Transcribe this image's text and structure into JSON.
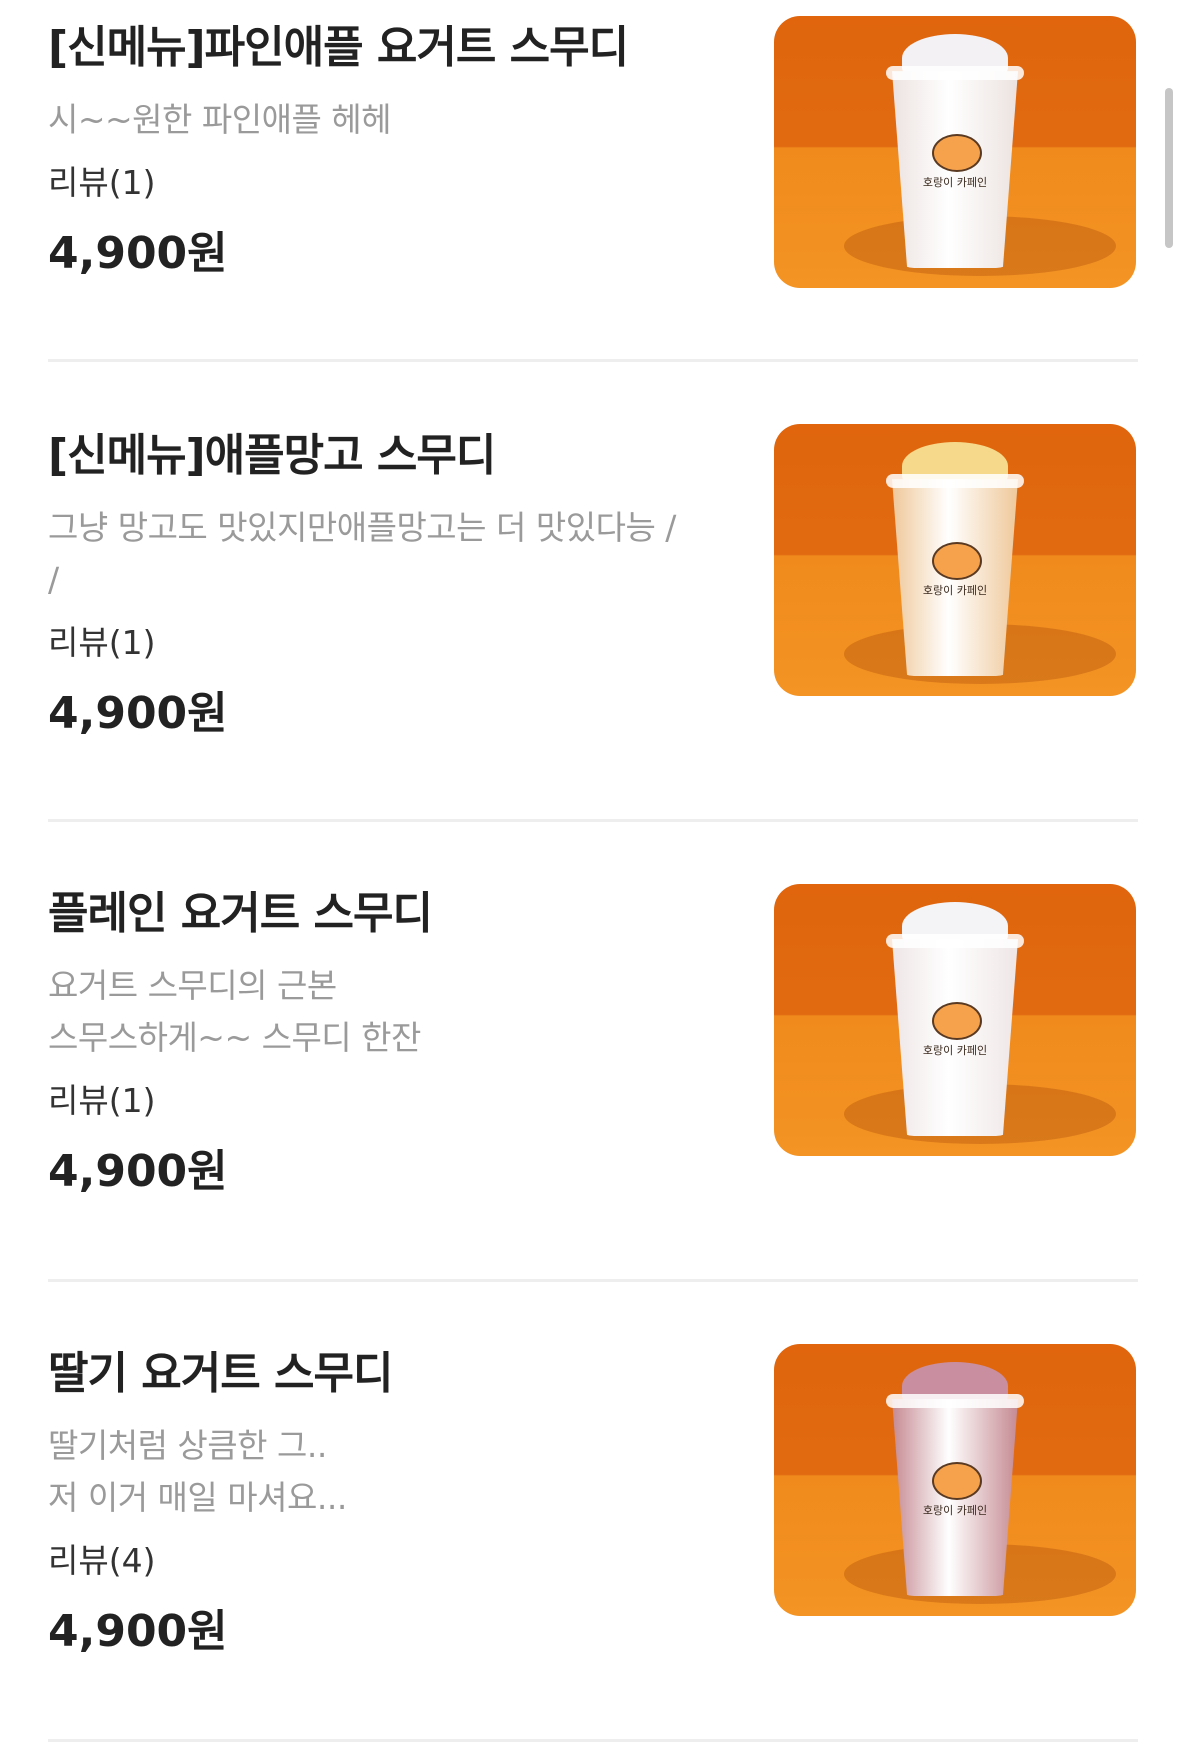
{
  "menu": {
    "items": [
      {
        "name": "[신메뉴]파인애플 요거트 스무디",
        "desc_lines": [
          "시~~원한 파인애플 헤헤"
        ],
        "review": "리뷰(1)",
        "price": "4,900원",
        "image_alt": "pineapple-yogurt-smoothie-photo",
        "cup_color": "#ece3e0",
        "foam_color": "#f3f1f4",
        "logo_text": "호랑이 카페인"
      },
      {
        "name": "[신메뉴]애플망고 스무디",
        "desc_lines": [
          "그냥 망고도 맛있지만애플망고는 더 맛있다능 /",
          " /"
        ],
        "review": "리뷰(1)",
        "price": "4,900원",
        "image_alt": "apple-mango-smoothie-photo",
        "cup_color": "#efc89a",
        "foam_color": "#f6d98a",
        "logo_text": "호랑이 카페인"
      },
      {
        "name": "플레인 요거트 스무디",
        "desc_lines": [
          "요거트 스무디의 근본",
          "스무스하게~~ 스무디 한잔"
        ],
        "review": "리뷰(1)",
        "price": "4,900원",
        "image_alt": "plain-yogurt-smoothie-photo",
        "cup_color": "#efe6e6",
        "foam_color": "#f4f3f6",
        "logo_text": "호랑이 카페인"
      },
      {
        "name": "딸기 요거트 스무디",
        "desc_lines": [
          "딸기처럼 상큼한 그..",
          "저 이거 매일 마셔요..."
        ],
        "review": "리뷰(4)",
        "price": "4,900원",
        "image_alt": "strawberry-yogurt-smoothie-photo",
        "cup_color": "#c58a92",
        "foam_color": "#c98fa0",
        "logo_text": "호랑이 카페인"
      }
    ]
  },
  "colors": {
    "background": "#ffffff",
    "title": "#222222",
    "description": "#9a9a9a",
    "divider": "#eeeeee",
    "photo_backdrop": "#e8700f"
  }
}
